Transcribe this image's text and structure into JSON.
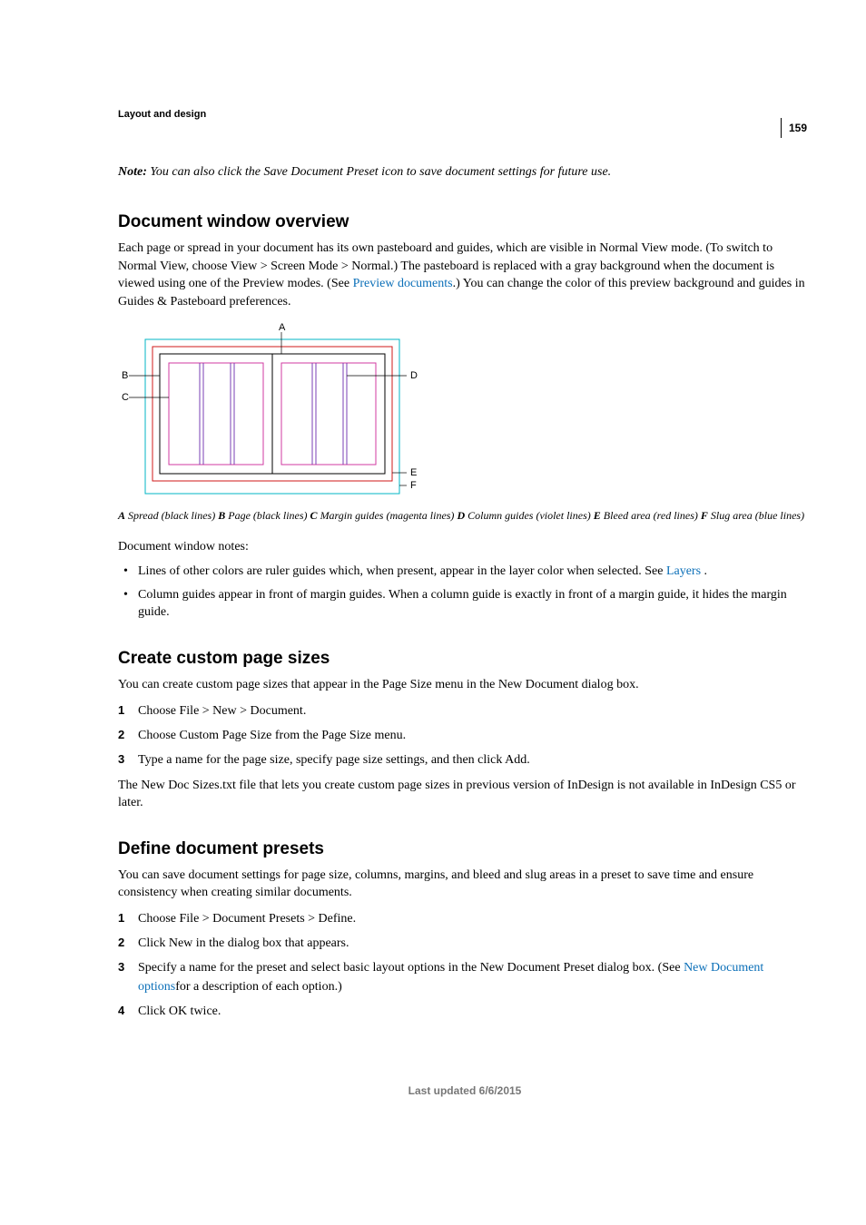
{
  "page_number": "159",
  "section_header": "Layout and design",
  "note": {
    "label": "Note:",
    "text": " You can also click the Save Document Preset icon to save document settings for future use."
  },
  "h_overview": "Document window overview",
  "overview_body_1a": "Each page or spread in your document has its own pasteboard and guides, which are visible in Normal View mode. (To switch to Normal View, choose View > Screen Mode > Normal.) The pasteboard is replaced with a gray background when the document is viewed using one of the Preview modes. (See ",
  "overview_link_1": "Preview documents",
  "overview_body_1b": ".) You can change the color of this preview background and guides in Guides & Pasteboard preferences.",
  "caption": {
    "A_lbl": "A",
    "A": " Spread (black lines)  ",
    "B_lbl": "B",
    "B": " Page (black lines)  ",
    "C_lbl": "C",
    "C": " Margin guides (magenta lines)  ",
    "D_lbl": "D",
    "D": " Column guides (violet lines)  ",
    "E_lbl": "E",
    "E": " Bleed area (red lines)  ",
    "F_lbl": "F",
    "F": " Slug area (blue lines)"
  },
  "dw_notes_intro": "Document window notes:",
  "bullets": {
    "b1a": "Lines of other colors are ruler guides which, when present, appear in the layer color when selected. See ",
    "b1_link": "Layers ",
    "b1b": ".",
    "b2": "Column guides appear in front of margin guides. When a column guide is exactly in front of a margin guide, it hides the margin guide."
  },
  "h_custom": "Create custom page sizes",
  "custom_intro": "You can create custom page sizes that appear in the Page Size menu in the New Document dialog box.",
  "custom_steps": {
    "s1": "Choose File > New > Document.",
    "s2": "Choose Custom Page Size from the Page Size menu.",
    "s3": "Type a name for the page size, specify page size settings, and then click Add."
  },
  "custom_after": "The New Doc Sizes.txt file that lets you create custom page sizes in previous version of InDesign is not available in InDesign CS5 or later.",
  "h_presets": "Define document presets",
  "presets_intro": "You can save document settings for page size, columns, margins, and bleed and slug areas in a preset to save time and ensure consistency when creating similar documents.",
  "presets_steps": {
    "s1": "Choose File > Document Presets > Define.",
    "s2": "Click New in the dialog box that appears.",
    "s3a": "Specify a name for the preset and select basic layout options in the New Document Preset dialog box. (See ",
    "s3_link": "New Document options",
    "s3b": "for a description of each option.)",
    "s4": "Click OK twice."
  },
  "footer": "Last updated 6/6/2015"
}
